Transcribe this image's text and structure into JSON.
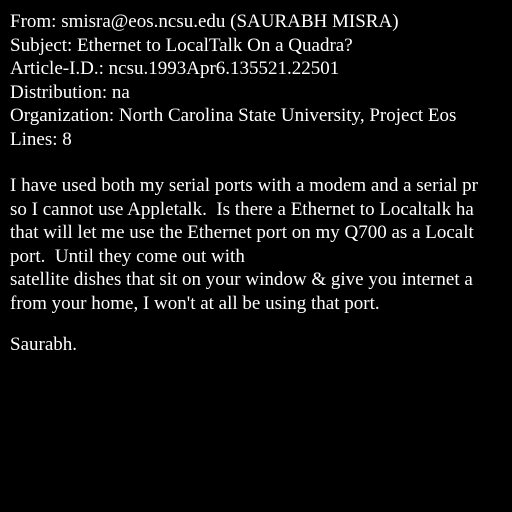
{
  "headers": {
    "from": "From: smisra@eos.ncsu.edu (SAURABH MISRA)",
    "subject": "Subject: Ethernet to LocalTalk On a Quadra?",
    "article_id": "Article-I.D.: ncsu.1993Apr6.135521.22501",
    "distribution": "Distribution: na",
    "organization": "Organization: North Carolina State University, Project Eos",
    "lines": "Lines: 8"
  },
  "body": {
    "line1": "I have used both my serial ports with a modem and a serial pr",
    "line2": "so I cannot use Appletalk.  Is there a Ethernet to Localtalk ha",
    "line3": "that will let me use the Ethernet port on my Q700 as a Localt",
    "line4": "port.  Until they come out with",
    "line5": "satellite dishes that sit on your window & give you internet a",
    "line6": "from your home, I won't at all be using that port."
  },
  "signature": "Saurabh."
}
